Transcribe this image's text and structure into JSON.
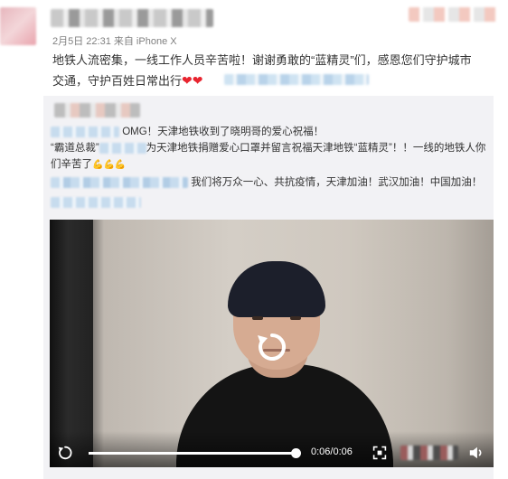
{
  "post": {
    "meta": "2月5日 22:31 来自 iPhone X",
    "text_line1": "地铁人流密集，一线工作人员辛苦啦！谢谢勇敢的“蓝精灵”们，感恩您们守护城市",
    "text_line2": "交通，守护百姓日常出行",
    "hearts": "❤❤"
  },
  "repost": {
    "line1_text": "OMG！天津地铁收到了晓明哥的爱心祝福！",
    "line2_prefix": "“霸道总裁”",
    "line2_text": "为天津地铁捐赠爱心口罩并留言祝福天津地铁“蓝精灵”！！一线的地铁人你",
    "line3_text": "们辛苦了",
    "line3_emoji": "💪💪💪",
    "line4_text": "我们将万众一心、共抗疫情，天津加油！武汉加油！中国加油！"
  },
  "video": {
    "progress_fraction": 1.0,
    "time": "0:06/0:06"
  },
  "icons": {
    "replay": "replay-icon",
    "fullscreen": "fullscreen-icon",
    "volume": "volume-icon"
  }
}
